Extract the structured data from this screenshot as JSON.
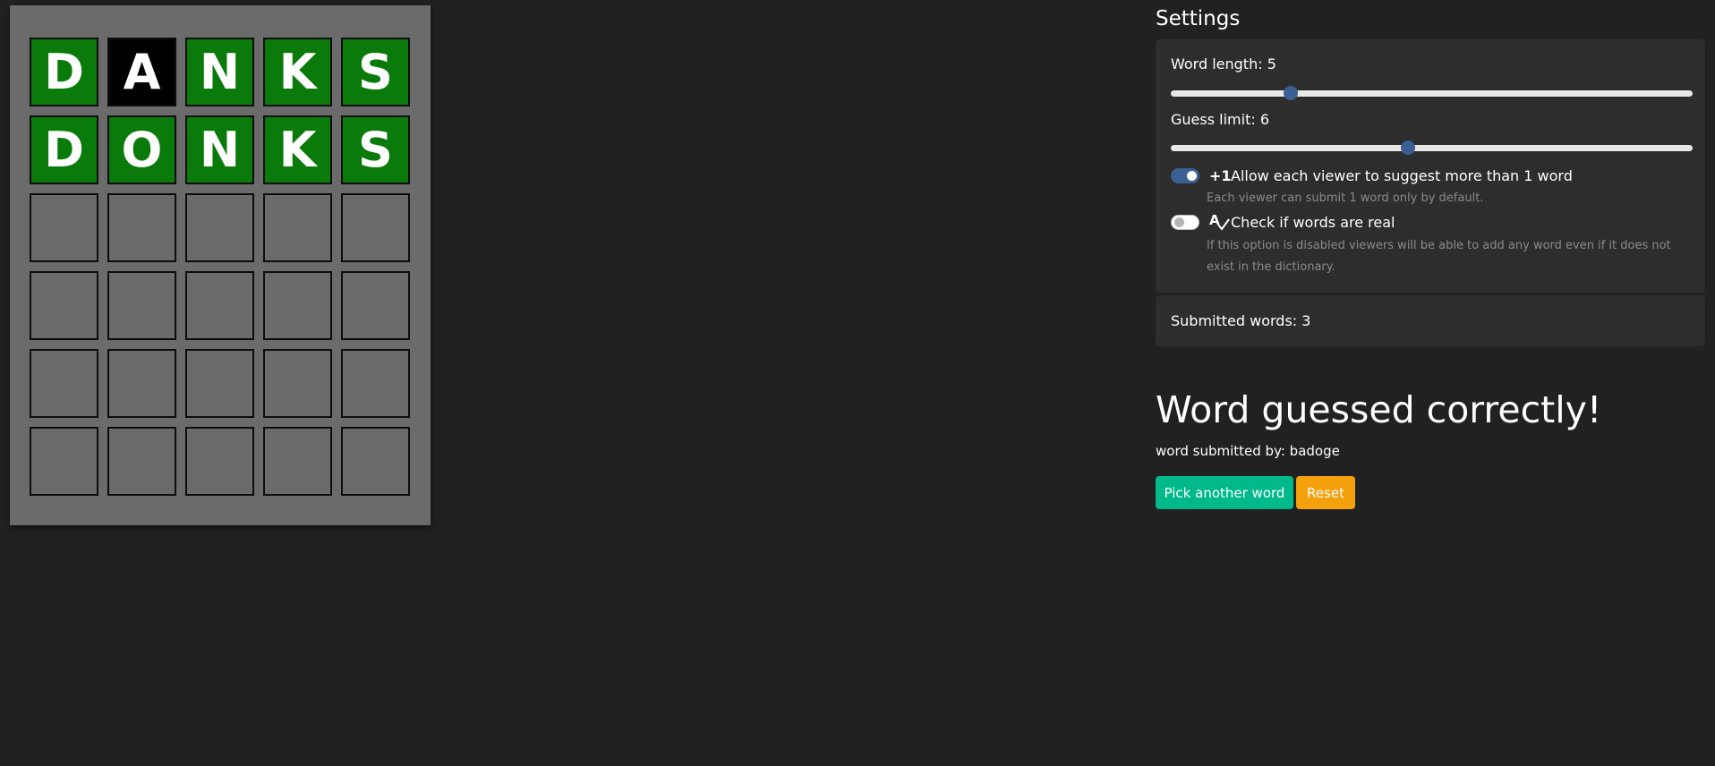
{
  "board": {
    "rows": [
      [
        {
          "letter": "D",
          "state": "green"
        },
        {
          "letter": "A",
          "state": "black"
        },
        {
          "letter": "N",
          "state": "green"
        },
        {
          "letter": "K",
          "state": "green"
        },
        {
          "letter": "S",
          "state": "green"
        }
      ],
      [
        {
          "letter": "D",
          "state": "green"
        },
        {
          "letter": "O",
          "state": "green"
        },
        {
          "letter": "N",
          "state": "green"
        },
        {
          "letter": "K",
          "state": "green"
        },
        {
          "letter": "S",
          "state": "green"
        }
      ],
      [
        {
          "letter": "",
          "state": "empty"
        },
        {
          "letter": "",
          "state": "empty"
        },
        {
          "letter": "",
          "state": "empty"
        },
        {
          "letter": "",
          "state": "empty"
        },
        {
          "letter": "",
          "state": "empty"
        }
      ],
      [
        {
          "letter": "",
          "state": "empty"
        },
        {
          "letter": "",
          "state": "empty"
        },
        {
          "letter": "",
          "state": "empty"
        },
        {
          "letter": "",
          "state": "empty"
        },
        {
          "letter": "",
          "state": "empty"
        }
      ],
      [
        {
          "letter": "",
          "state": "empty"
        },
        {
          "letter": "",
          "state": "empty"
        },
        {
          "letter": "",
          "state": "empty"
        },
        {
          "letter": "",
          "state": "empty"
        },
        {
          "letter": "",
          "state": "empty"
        }
      ],
      [
        {
          "letter": "",
          "state": "empty"
        },
        {
          "letter": "",
          "state": "empty"
        },
        {
          "letter": "",
          "state": "empty"
        },
        {
          "letter": "",
          "state": "empty"
        },
        {
          "letter": "",
          "state": "empty"
        }
      ]
    ],
    "colors": {
      "green": "#0a7a0a",
      "black": "#000000",
      "empty": "#6b6b6b"
    }
  },
  "settings": {
    "title": "Settings",
    "word_length": {
      "label": "Word length: 5",
      "value": 5,
      "fraction": 0.23
    },
    "guess_limit": {
      "label": "Guess limit: 6",
      "value": 6,
      "fraction": 0.455
    },
    "multi_word": {
      "icon": "plus-one-icon",
      "icon_text": "+1",
      "label": "Allow each viewer to suggest more than 1 word",
      "help": "Each viewer can submit 1 word only by default.",
      "enabled": true
    },
    "check_real": {
      "icon": "spellcheck-icon",
      "label": "Check if words are real",
      "help": "If this option is disabled viewers will be able to add any word even if it does not exist in the dictionary.",
      "enabled": false
    },
    "accent_color": "#3b5e93"
  },
  "submitted": {
    "label": "Submitted words: 3"
  },
  "result": {
    "title": "Word guessed correctly!",
    "submitted_by": "word submitted by: badoge"
  },
  "buttons": {
    "pick": {
      "label": "Pick another word",
      "color": "#00b98a"
    },
    "reset": {
      "label": "Reset",
      "color": "#f5a00d"
    }
  }
}
